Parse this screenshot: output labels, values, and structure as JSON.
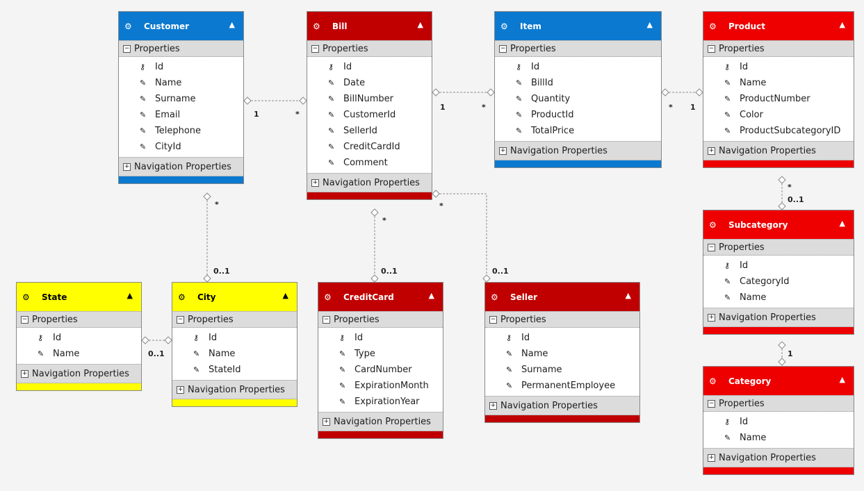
{
  "colors": {
    "blue": "#0b79d0",
    "darkred": "#c00000",
    "red": "#ee0000",
    "yellow": "#ffff00"
  },
  "labels": {
    "properties": "Properties",
    "navigation": "Navigation Properties"
  },
  "entities": {
    "customer": {
      "title": "Customer",
      "props": [
        "Id",
        "Name",
        "Surname",
        "Email",
        "Telephone",
        "CityId"
      ]
    },
    "bill": {
      "title": "Bill",
      "props": [
        "Id",
        "Date",
        "BillNumber",
        "CustomerId",
        "SellerId",
        "CreditCardId",
        "Comment"
      ]
    },
    "item": {
      "title": "Item",
      "props": [
        "Id",
        "BillId",
        "Quantity",
        "ProductId",
        "TotalPrice"
      ]
    },
    "product": {
      "title": "Product",
      "props": [
        "Id",
        "Name",
        "ProductNumber",
        "Color",
        "ProductSubcategoryID"
      ]
    },
    "subcategory": {
      "title": "Subcategory",
      "props": [
        "Id",
        "CategoryId",
        "Name"
      ]
    },
    "category": {
      "title": "Category",
      "props": [
        "Id",
        "Name"
      ]
    },
    "state": {
      "title": "State",
      "props": [
        "Id",
        "Name"
      ]
    },
    "city": {
      "title": "City",
      "props": [
        "Id",
        "Name",
        "StateId"
      ]
    },
    "creditcard": {
      "title": "CreditCard",
      "props": [
        "Id",
        "Type",
        "CardNumber",
        "ExpirationMonth",
        "ExpirationYear"
      ]
    },
    "seller": {
      "title": "Seller",
      "props": [
        "Id",
        "Name",
        "Surname",
        "PermanentEmployee"
      ]
    }
  },
  "multiplicities": {
    "cust_bill_1": "1",
    "cust_bill_many": "*",
    "bill_item_1": "1",
    "bill_item_many": "*",
    "item_prod_many": "*",
    "item_prod_1": "1",
    "prod_sub_many": "*",
    "prod_sub_01": "0..1",
    "sub_cat_1": "1",
    "cust_city_many": "*",
    "cust_city_01": "0..1",
    "bill_cc_many": "*",
    "bill_cc_01": "0..1",
    "bill_seller_many": "*",
    "bill_seller_01": "0..1",
    "state_city_01": "0..1"
  }
}
